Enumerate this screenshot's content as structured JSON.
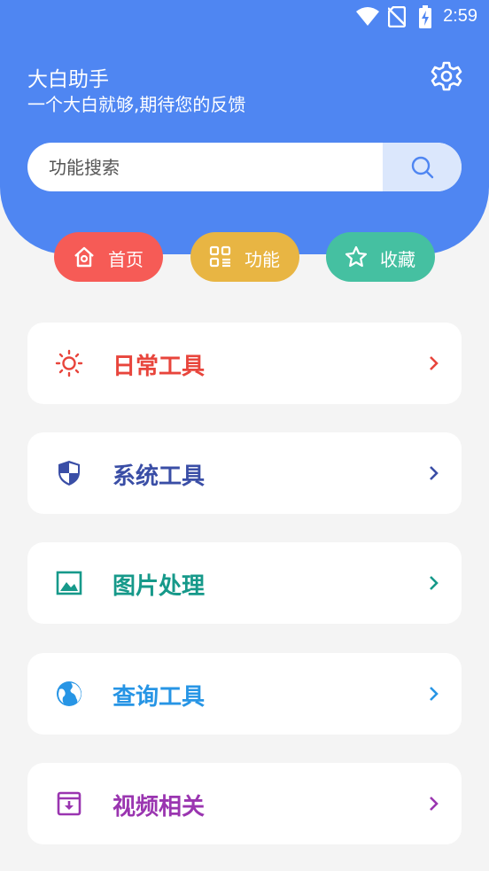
{
  "status_bar": {
    "time": "2:59",
    "icons": [
      "wifi-icon",
      "no-sim-icon",
      "battery-charging-icon"
    ]
  },
  "header": {
    "title": "大白助手",
    "subtitle": "一个大白就够,期待您的反馈",
    "settings_icon": "gear-icon",
    "background_color": "#4f86f2"
  },
  "search": {
    "placeholder": "功能搜索",
    "value": "",
    "button_icon": "search-icon"
  },
  "nav_pills": [
    {
      "label": "首页",
      "icon": "home-icon",
      "color": "#f65b56"
    },
    {
      "label": "功能",
      "icon": "apps-grid-icon",
      "color": "#e8b543"
    },
    {
      "label": "收藏",
      "icon": "star-icon",
      "color": "#45c0a1"
    }
  ],
  "categories": [
    {
      "label": "日常工具",
      "icon": "sun-icon",
      "color": "#e8453c"
    },
    {
      "label": "系统工具",
      "icon": "shield-icon",
      "color": "#3a4ea6"
    },
    {
      "label": "图片处理",
      "icon": "image-icon",
      "color": "#16998a"
    },
    {
      "label": "查询工具",
      "icon": "globe-icon",
      "color": "#2795e5"
    },
    {
      "label": "视频相关",
      "icon": "archive-box-icon",
      "color": "#9a35b0"
    }
  ]
}
